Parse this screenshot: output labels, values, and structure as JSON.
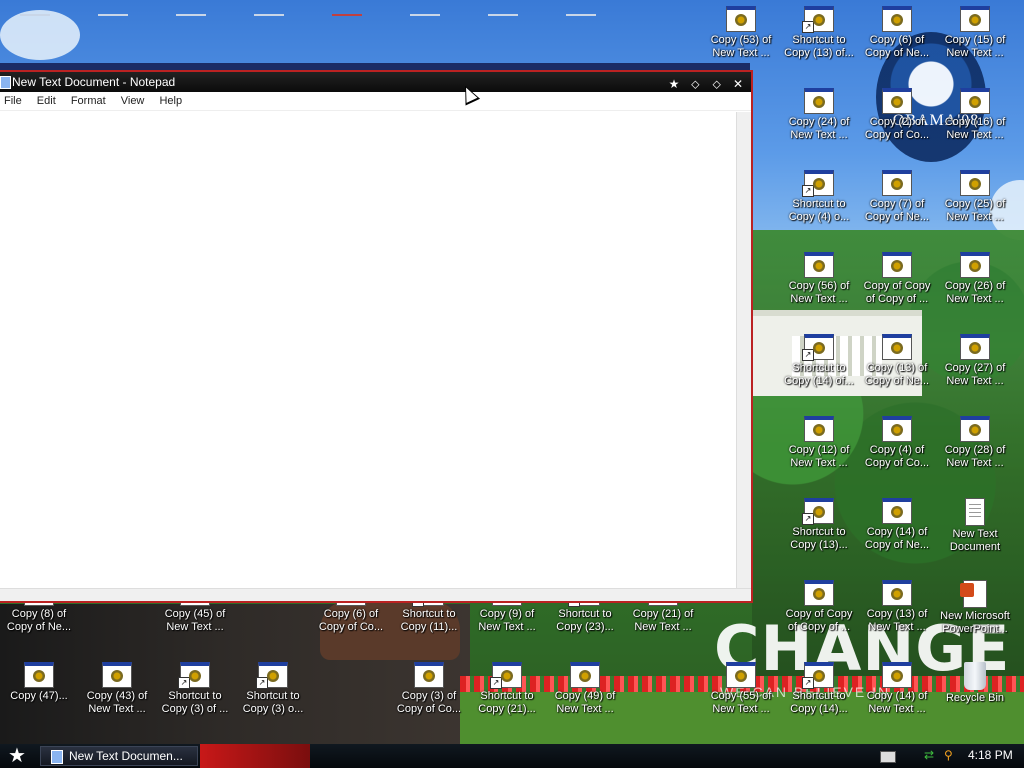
{
  "wallpaper": {
    "obama_text": "OBAMA'08",
    "change_text": "CHANGE",
    "change_sub": "WE CAN BELIEVE IN"
  },
  "desktop_icons": [
    {
      "label": "Copy (53) of New Text ...",
      "type": "app",
      "shortcut": false
    },
    {
      "label": "Shortcut to Copy (13) of...",
      "type": "app",
      "shortcut": true
    },
    {
      "label": "Copy (6) of Copy of Ne...",
      "type": "app",
      "shortcut": false
    },
    {
      "label": "Copy (15) of New Text ...",
      "type": "app",
      "shortcut": false
    },
    {
      "label": "Copy (24) of New Text ...",
      "type": "app",
      "shortcut": false
    },
    {
      "label": "Copy (2) of Copy of Co...",
      "type": "app",
      "shortcut": false
    },
    {
      "label": "Copy (16) of New Text ...",
      "type": "app",
      "shortcut": false
    },
    {
      "label": "Shortcut to Copy (4) o...",
      "type": "app",
      "shortcut": true
    },
    {
      "label": "Copy (7) of Copy of Ne...",
      "type": "app",
      "shortcut": false
    },
    {
      "label": "Copy (25) of New Text ...",
      "type": "app",
      "shortcut": false
    },
    {
      "label": "Copy (56) of New Text ...",
      "type": "app",
      "shortcut": false
    },
    {
      "label": "Copy of Copy of Copy of ...",
      "type": "app",
      "shortcut": false
    },
    {
      "label": "Copy (26) of New Text ...",
      "type": "app",
      "shortcut": false
    },
    {
      "label": "Shortcut to Copy (14) of...",
      "type": "app",
      "shortcut": true
    },
    {
      "label": "Copy (13) of Copy of Ne...",
      "type": "app",
      "shortcut": false
    },
    {
      "label": "Copy (27) of New Text ...",
      "type": "app",
      "shortcut": false
    },
    {
      "label": "Copy (12) of New Text ...",
      "type": "app",
      "shortcut": false
    },
    {
      "label": "Copy (4) of Copy of Co...",
      "type": "app",
      "shortcut": false
    },
    {
      "label": "Copy (28) of New Text ...",
      "type": "app",
      "shortcut": false
    },
    {
      "label": "Shortcut to Copy (13)...",
      "type": "app",
      "shortcut": true
    },
    {
      "label": "Copy (14) of Copy of Ne...",
      "type": "app",
      "shortcut": false
    },
    {
      "label": "New Text Document",
      "type": "doc",
      "shortcut": false
    },
    {
      "label": "Copy of Copy of Copy of ...",
      "type": "app",
      "shortcut": false
    },
    {
      "label": "Copy (13) of New Text ...",
      "type": "app",
      "shortcut": false
    },
    {
      "label": "New Microsoft PowerPoint...",
      "type": "ppt",
      "shortcut": false
    },
    {
      "label": "Copy (8) of Copy of Ne...",
      "type": "app",
      "shortcut": false
    },
    {
      "label": "Copy (45) of New Text ...",
      "type": "app",
      "shortcut": false
    },
    {
      "label": "Copy (6) of Copy of Co...",
      "type": "app",
      "shortcut": false
    },
    {
      "label": "Shortcut to Copy (11)...",
      "type": "app",
      "shortcut": true
    },
    {
      "label": "Copy (9) of New Text ...",
      "type": "app",
      "shortcut": false
    },
    {
      "label": "Shortcut to Copy (23)...",
      "type": "app",
      "shortcut": true
    },
    {
      "label": "Copy (21) of New Text ...",
      "type": "app",
      "shortcut": false
    },
    {
      "label": "Copy (47)...",
      "type": "app",
      "shortcut": false
    },
    {
      "label": "Copy (43) of New Text ...",
      "type": "app",
      "shortcut": false
    },
    {
      "label": "Shortcut to Copy (3) of ...",
      "type": "app",
      "shortcut": true
    },
    {
      "label": "Shortcut to Copy (3) o...",
      "type": "app",
      "shortcut": true
    },
    {
      "label": "Copy (3) of Copy of Co...",
      "type": "app",
      "shortcut": false
    },
    {
      "label": "Shortcut to Copy (21)...",
      "type": "app",
      "shortcut": true
    },
    {
      "label": "Copy (49) of New Text ...",
      "type": "app",
      "shortcut": false
    },
    {
      "label": "Copy (55) of New Text ...",
      "type": "app",
      "shortcut": false
    },
    {
      "label": "Shortcut to Copy (14)...",
      "type": "app",
      "shortcut": true
    },
    {
      "label": "Copy (14) of New Text ...",
      "type": "app",
      "shortcut": false
    },
    {
      "label": "Recycle Bin",
      "type": "bin",
      "shortcut": false
    }
  ],
  "notepad": {
    "title": "New Text Document - Notepad",
    "menu": [
      "File",
      "Edit",
      "Format",
      "View",
      "Help"
    ],
    "content": "",
    "buttons": {
      "minimize": "⬦",
      "maximize": "⬦",
      "close": "✕",
      "star": "★"
    }
  },
  "taskbar": {
    "start_label": "★",
    "task_label": "New Text Documen...",
    "clock": "4:18 PM"
  }
}
